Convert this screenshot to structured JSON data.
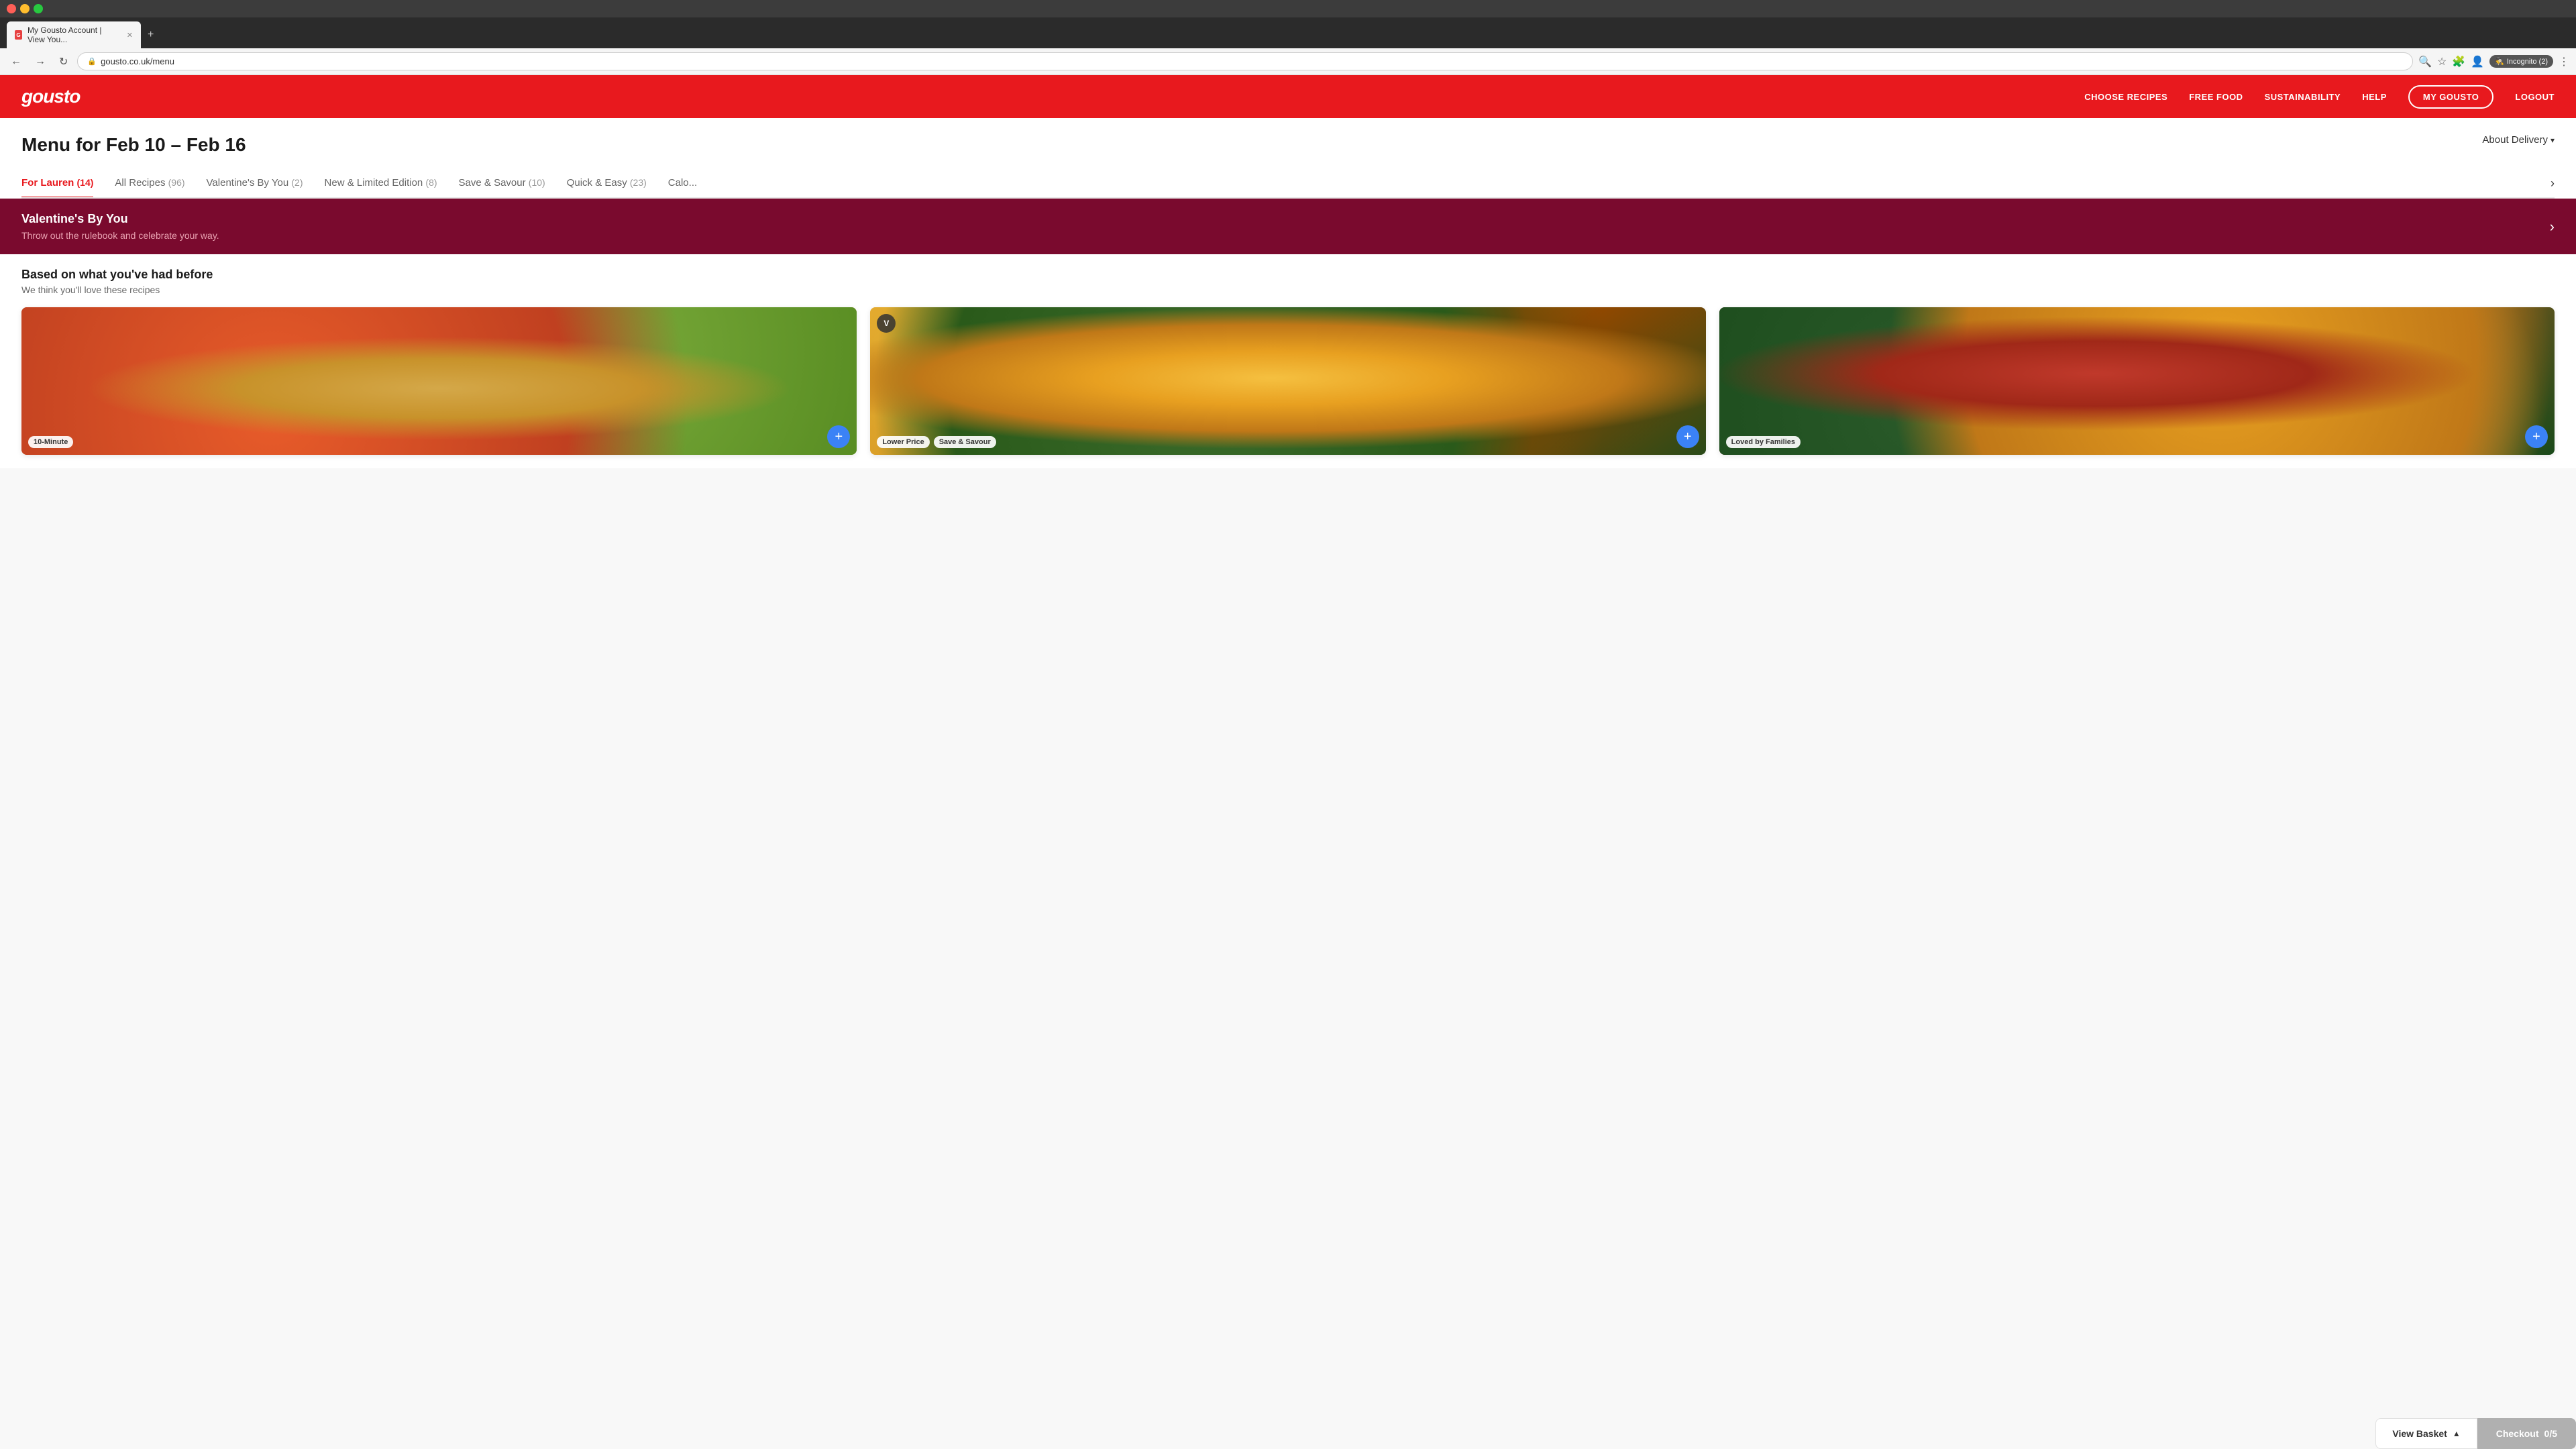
{
  "browser": {
    "tab_title": "My Gousto Account | View You...",
    "url": "gousto.co.uk/menu",
    "new_tab_label": "+",
    "incognito_label": "Incognito (2)",
    "back_disabled": false,
    "forward_disabled": false
  },
  "header": {
    "logo": "gousto",
    "nav": {
      "choose_recipes": "CHOOSE RECIPES",
      "free_food": "FREE FOOD",
      "sustainability": "SUSTAINABILITY",
      "help": "HELP",
      "my_gousto": "MY GOUSTO",
      "logout": "LOGOUT"
    }
  },
  "page": {
    "title": "Menu for Feb 10 – Feb 16",
    "about_delivery": "About Delivery",
    "filters": [
      {
        "label": "For Lauren",
        "count": "(14)",
        "active": true
      },
      {
        "label": "All Recipes",
        "count": "(96)",
        "active": false
      },
      {
        "label": "Valentine's By You",
        "count": "(2)",
        "active": false
      },
      {
        "label": "New & Limited Edition",
        "count": "(8)",
        "active": false
      },
      {
        "label": "Save & Savour",
        "count": "(10)",
        "active": false
      },
      {
        "label": "Quick & Easy",
        "count": "(23)",
        "active": false
      },
      {
        "label": "Calo...",
        "count": "",
        "active": false
      }
    ],
    "banner": {
      "title": "Valentine's By You",
      "subtitle": "Throw out the rulebook and celebrate your way."
    },
    "section": {
      "title": "Based on what you've had before",
      "subtitle": "We think you'll love these recipes"
    },
    "recipes": [
      {
        "tags": [
          "10-Minute"
        ],
        "badge": null,
        "add_label": "+"
      },
      {
        "tags": [
          "Lower Price",
          "Save & Savour"
        ],
        "badge": "V",
        "add_label": "+"
      },
      {
        "tags": [
          "Loved by Families"
        ],
        "badge": null,
        "add_label": "+"
      }
    ]
  },
  "bottom_bar": {
    "view_basket": "View Basket",
    "checkout": "Checkout",
    "basket_count": "0/5"
  }
}
